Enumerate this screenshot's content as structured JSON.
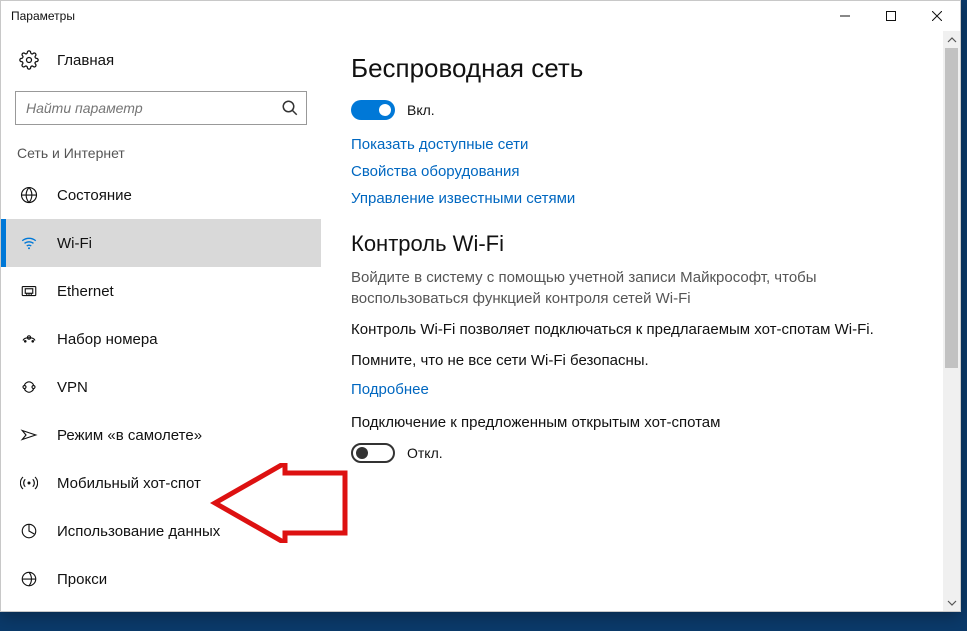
{
  "window": {
    "title": "Параметры"
  },
  "sidebar": {
    "home": "Главная",
    "search_placeholder": "Найти параметр",
    "category": "Сеть и Интернет",
    "items": [
      {
        "label": "Состояние"
      },
      {
        "label": "Wi-Fi"
      },
      {
        "label": "Ethernet"
      },
      {
        "label": "Набор номера"
      },
      {
        "label": "VPN"
      },
      {
        "label": "Режим «в самолете»"
      },
      {
        "label": "Мобильный хот-спот"
      },
      {
        "label": "Использование данных"
      },
      {
        "label": "Прокси"
      }
    ]
  },
  "main": {
    "h1": "Беспроводная сеть",
    "wifi_toggle_label": "Вкл.",
    "links": {
      "show_networks": "Показать доступные сети",
      "hw_props": "Свойства оборудования",
      "manage_known": "Управление известными сетями",
      "more": "Подробнее"
    },
    "wifi_sense": {
      "h2": "Контроль Wi-Fi",
      "p1": "Войдите в систему с помощью учетной записи Майкрософт, чтобы воспользоваться функцией контроля сетей Wi-Fi",
      "p2": "Контроль Wi-Fi позволяет подключаться к предлагаемым хот-спотам Wi-Fi.",
      "p3": "Помните, что не все сети Wi-Fi безопасны.",
      "p4": "Подключение к предложенным открытым хот-спотам",
      "off_label": "Откл."
    }
  }
}
